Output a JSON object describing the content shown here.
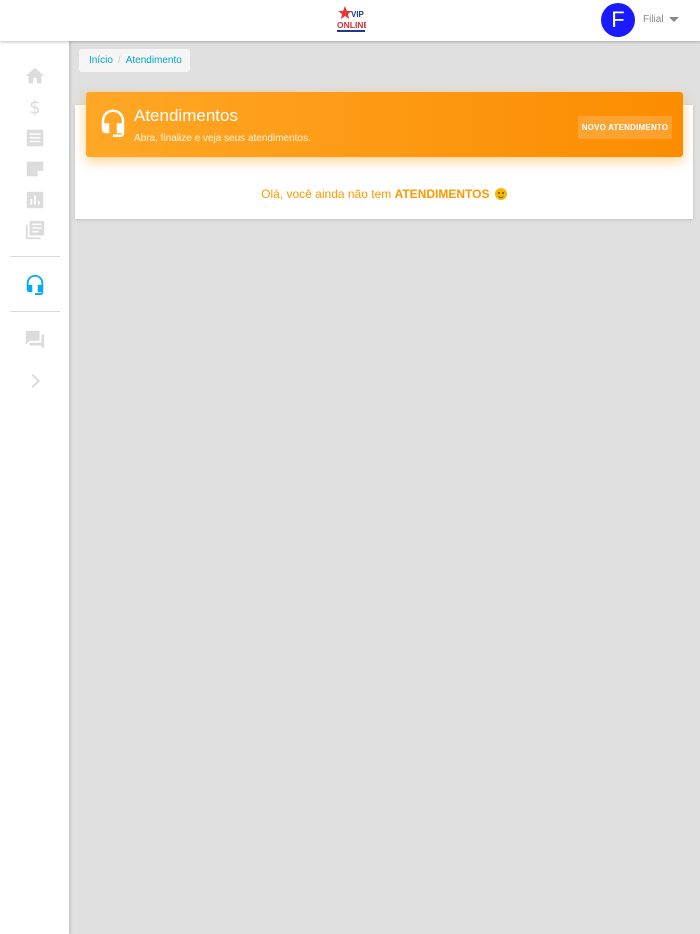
{
  "header": {
    "logo_text": "VIP ONLINE",
    "avatar_initial": "F",
    "user_name": "Filial"
  },
  "sidebar": {
    "items": [
      {
        "icon": "home-icon"
      },
      {
        "icon": "dollar-icon"
      },
      {
        "icon": "list-icon"
      },
      {
        "icon": "note-icon"
      },
      {
        "icon": "chart-icon"
      },
      {
        "icon": "library-books-icon"
      },
      {
        "icon": "headset-icon",
        "active": true
      },
      {
        "icon": "forum-icon"
      },
      {
        "icon": "chevron-right-icon"
      }
    ],
    "active_color": "#03a9f4",
    "icon_color": "#dcdcdc"
  },
  "breadcrumb": {
    "items": [
      "Início",
      "Atendimento"
    ]
  },
  "card": {
    "title": "Atendimentos",
    "subtitle": "Abra, finalize e veja seus atendimentos.",
    "button_label": "NOVO ATENDIMENTO",
    "header_color": "#ff9800"
  },
  "empty_state": {
    "prefix": "Olá, você ainda não tem",
    "highlight": "ATENDIMENTOS",
    "emoji_icon": "smiley-icon"
  }
}
